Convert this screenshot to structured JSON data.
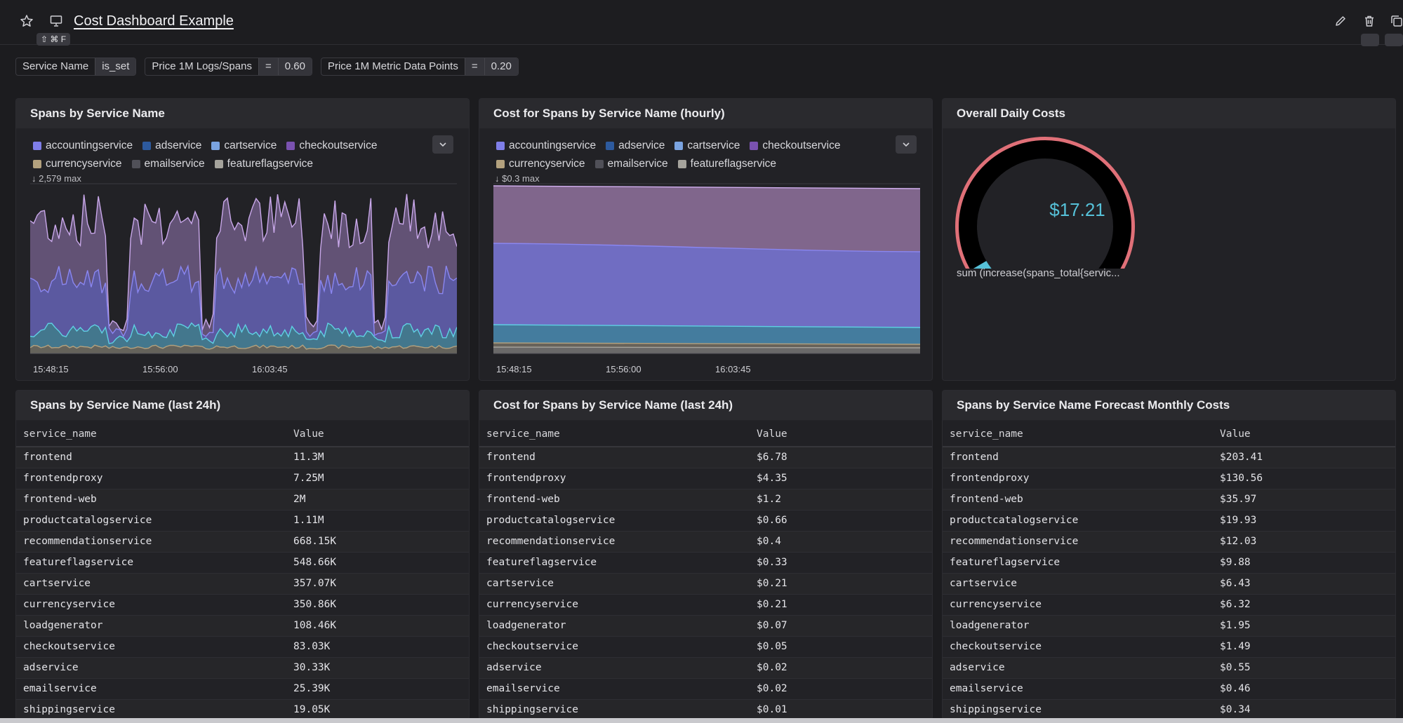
{
  "header": {
    "title": "Cost Dashboard Example",
    "shortcut": "⇧ ⌘ F"
  },
  "filters": [
    {
      "key": "Service Name",
      "op": "",
      "value": "is_set"
    },
    {
      "key": "Price 1M Logs/Spans",
      "op": "=",
      "value": "0.60"
    },
    {
      "key": "Price 1M Metric Data Points",
      "op": "=",
      "value": "0.20"
    }
  ],
  "legend_items": [
    {
      "label": "accountingservice",
      "color": "#7f7ee8"
    },
    {
      "label": "adservice",
      "color": "#2d5a9e"
    },
    {
      "label": "cartservice",
      "color": "#7aa3e0"
    },
    {
      "label": "checkoutservice",
      "color": "#7a52b0"
    },
    {
      "label": "currencyservice",
      "color": "#b3a17e"
    },
    {
      "label": "emailservice",
      "color": "#505058"
    },
    {
      "label": "featureflagservice",
      "color": "#a5a39c"
    }
  ],
  "panels": {
    "spans_chart": {
      "title": "Spans by Service Name",
      "max_label": "↓ 2,579 max",
      "x_ticks": [
        "15:48:15",
        "15:56:00",
        "16:03:45"
      ]
    },
    "cost_chart": {
      "title": "Cost for Spans by Service Name (hourly)",
      "max_label": "↓ $0.3 max",
      "x_ticks": [
        "15:48:15",
        "15:56:00",
        "16:03:45"
      ]
    },
    "gauge": {
      "title": "Overall Daily Costs",
      "value": "$17.21",
      "fraction": 0.07,
      "caption": "sum (increase(spans_total{servic..."
    },
    "spans_table": {
      "title": "Spans by Service Name (last 24h)",
      "col1": "service_name",
      "col2": "Value",
      "rows": [
        [
          "frontend",
          "11.3M"
        ],
        [
          "frontendproxy",
          "7.25M"
        ],
        [
          "frontend-web",
          "2M"
        ],
        [
          "productcatalogservice",
          "1.11M"
        ],
        [
          "recommendationservice",
          "668.15K"
        ],
        [
          "featureflagservice",
          "548.66K"
        ],
        [
          "cartservice",
          "357.07K"
        ],
        [
          "currencyservice",
          "350.86K"
        ],
        [
          "loadgenerator",
          "108.46K"
        ],
        [
          "checkoutservice",
          "83.03K"
        ],
        [
          "adservice",
          "30.33K"
        ],
        [
          "emailservice",
          "25.39K"
        ],
        [
          "shippingservice",
          "19.05K"
        ]
      ]
    },
    "cost_table": {
      "title": "Cost for Spans by Service Name (last 24h)",
      "col1": "service_name",
      "col2": "Value",
      "rows": [
        [
          "frontend",
          "$6.78"
        ],
        [
          "frontendproxy",
          "$4.35"
        ],
        [
          "frontend-web",
          "$1.2"
        ],
        [
          "productcatalogservice",
          "$0.66"
        ],
        [
          "recommendationservice",
          "$0.4"
        ],
        [
          "featureflagservice",
          "$0.33"
        ],
        [
          "cartservice",
          "$0.21"
        ],
        [
          "currencyservice",
          "$0.21"
        ],
        [
          "loadgenerator",
          "$0.07"
        ],
        [
          "checkoutservice",
          "$0.05"
        ],
        [
          "adservice",
          "$0.02"
        ],
        [
          "emailservice",
          "$0.02"
        ],
        [
          "shippingservice",
          "$0.01"
        ]
      ]
    },
    "forecast_table": {
      "title": "Spans by Service Name Forecast Monthly Costs",
      "col1": "service_name",
      "col2": "Value",
      "rows": [
        [
          "frontend",
          "$203.41"
        ],
        [
          "frontendproxy",
          "$130.56"
        ],
        [
          "frontend-web",
          "$35.97"
        ],
        [
          "productcatalogservice",
          "$19.93"
        ],
        [
          "recommendationservice",
          "$12.03"
        ],
        [
          "featureflagservice",
          "$9.88"
        ],
        [
          "cartservice",
          "$6.43"
        ],
        [
          "currencyservice",
          "$6.32"
        ],
        [
          "loadgenerator",
          "$1.95"
        ],
        [
          "checkoutservice",
          "$1.49"
        ],
        [
          "adservice",
          "$0.55"
        ],
        [
          "emailservice",
          "$0.46"
        ],
        [
          "shippingservice",
          "$0.34"
        ]
      ]
    }
  }
}
